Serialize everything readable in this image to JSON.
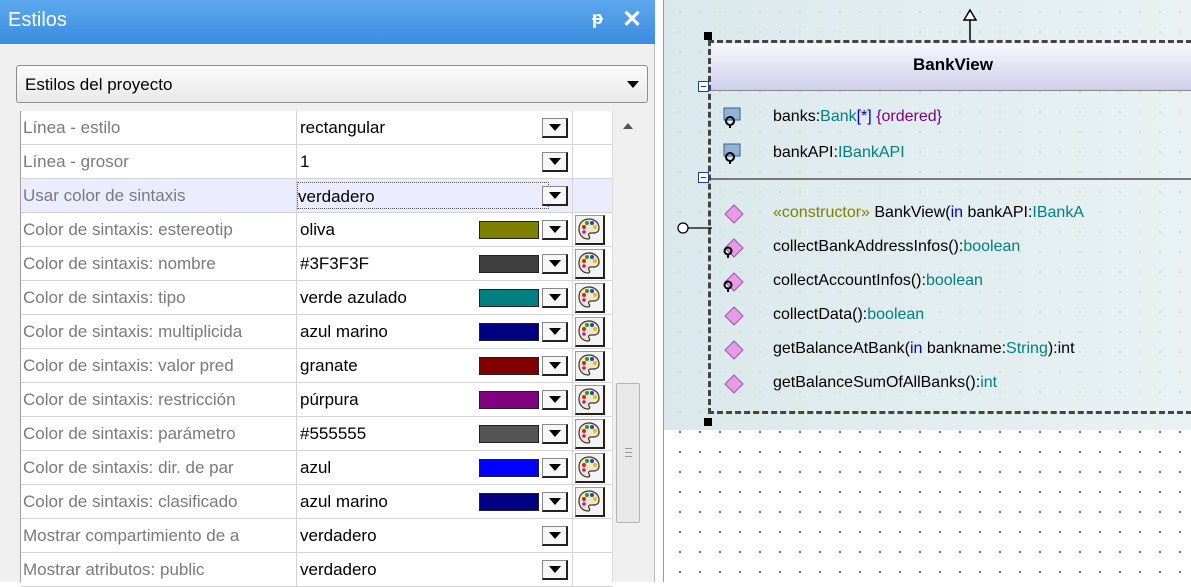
{
  "panel": {
    "title": "Estilos",
    "pin_glyph": "ᵽ",
    "close_glyph": "✕",
    "scope": "Estilos del proyecto",
    "rows": [
      {
        "label": "Línea - estilo",
        "value": "rectangular",
        "swatch": null,
        "palette": false
      },
      {
        "label": "Línea - grosor",
        "value": "1",
        "swatch": null,
        "palette": false
      },
      {
        "label": "Usar color de sintaxis",
        "value": "verdadero",
        "swatch": null,
        "palette": false,
        "selected": true
      },
      {
        "label": "Color de sintaxis: estereotip",
        "value": "oliva",
        "swatch": "#808000",
        "palette": true
      },
      {
        "label": "Color de sintaxis: nombre",
        "value": "#3F3F3F",
        "swatch": "#3f3f3f",
        "palette": true
      },
      {
        "label": "Color de sintaxis: tipo",
        "value": "verde azulado",
        "swatch": "#008080",
        "palette": true
      },
      {
        "label": "Color de sintaxis: multiplicida",
        "value": "azul marino",
        "swatch": "#000080",
        "palette": true
      },
      {
        "label": "Color de sintaxis: valor pred",
        "value": "granate",
        "swatch": "#800000",
        "palette": true
      },
      {
        "label": "Color de sintaxis: restricción",
        "value": "púrpura",
        "swatch": "#800080",
        "palette": true
      },
      {
        "label": "Color de sintaxis: parámetro",
        "value": "#555555",
        "swatch": "#555555",
        "palette": true
      },
      {
        "label": "Color de sintaxis: dir. de par",
        "value": "azul",
        "swatch": "#0000ff",
        "palette": true
      },
      {
        "label": "Color de sintaxis: clasificado",
        "value": "azul marino",
        "swatch": "#000080",
        "palette": true
      },
      {
        "label": "Mostrar compartimiento de a",
        "value": "verdadero",
        "swatch": null,
        "palette": false
      },
      {
        "label": "Mostrar atributos: public",
        "value": "verdadero",
        "swatch": null,
        "palette": false
      }
    ]
  },
  "uml": {
    "class_name": "BankView",
    "attributes": [
      {
        "icon": "private-attribute-key-icon",
        "parts": [
          [
            "",
            "banks:"
          ],
          [
            "ty",
            "Bank"
          ],
          [
            "kw",
            "[*]"
          ],
          [
            "",
            "  "
          ],
          [
            "cs",
            "{ordered}"
          ]
        ]
      },
      {
        "icon": "private-attribute-key-icon",
        "parts": [
          [
            "",
            "bankAPI:"
          ],
          [
            "ty",
            "IBankAPI"
          ]
        ]
      }
    ],
    "operations": [
      {
        "icon": "public-operation-icon",
        "parts": [
          [
            "st",
            "«constructor»"
          ],
          [
            "",
            " BankView("
          ],
          [
            "kw",
            "in"
          ],
          [
            "",
            " bankAPI:"
          ],
          [
            "ty",
            "IBankA"
          ]
        ]
      },
      {
        "icon": "private-operation-icon",
        "parts": [
          [
            "",
            "collectBankAddressInfos():"
          ],
          [
            "ty",
            "boolean"
          ]
        ]
      },
      {
        "icon": "private-operation-icon",
        "parts": [
          [
            "",
            "collectAccountInfos():"
          ],
          [
            "ty",
            "boolean"
          ]
        ]
      },
      {
        "icon": "public-operation-icon",
        "parts": [
          [
            "",
            "collectData():"
          ],
          [
            "ty",
            "boolean"
          ]
        ]
      },
      {
        "icon": "public-operation-icon",
        "parts": [
          [
            "",
            "getBalanceAtBank("
          ],
          [
            "kw",
            "in"
          ],
          [
            "",
            " bankname:"
          ],
          [
            "ty",
            "String"
          ],
          [
            "",
            "):int"
          ]
        ]
      },
      {
        "icon": "public-operation-icon",
        "parts": [
          [
            "",
            "getBalanceSumOfAllBanks():"
          ],
          [
            "ty",
            "int"
          ]
        ]
      }
    ]
  }
}
